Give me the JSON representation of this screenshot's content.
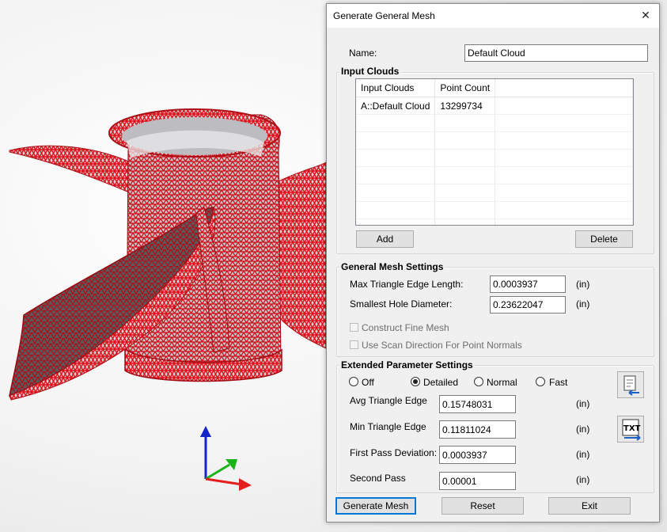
{
  "dialog": {
    "title": "Generate General Mesh",
    "close_glyph": "✕",
    "name_label": "Name:",
    "name_value": "Default Cloud"
  },
  "input_clouds": {
    "group_title": "Input Clouds",
    "columns": [
      "Input Clouds",
      "Point Count"
    ],
    "rows": [
      {
        "cloud": "A::Default Cloud",
        "count": "13299734"
      }
    ],
    "add_label": "Add",
    "delete_label": "Delete"
  },
  "general_settings": {
    "group_title": "General Mesh Settings",
    "max_edge_label": "Max Triangle Edge Length:",
    "max_edge_value": "0.0003937",
    "hole_label": "Smallest Hole Diameter:",
    "hole_value": "0.23622047",
    "unit": "(in)",
    "fine_mesh_label": "Construct Fine Mesh",
    "scan_dir_label": "Use Scan Direction For Point Normals"
  },
  "extended": {
    "group_title": "Extended Parameter Settings",
    "modes": [
      "Off",
      "Detailed",
      "Normal",
      "Fast"
    ],
    "selected_mode": "Detailed",
    "avg_label": "Avg Triangle Edge",
    "avg_value": "0.15748031",
    "min_label": "Min Triangle Edge",
    "min_value": "0.11811024",
    "first_label": "First Pass Deviation:",
    "first_value": "0.0003937",
    "second_label": "Second Pass",
    "second_value": "0.00001",
    "unit": "(in)",
    "txt_icon_label": "TXT"
  },
  "footer": {
    "generate_label": "Generate Mesh",
    "reset_label": "Reset",
    "exit_label": "Exit"
  },
  "colors": {
    "mesh_red": "#e0101a",
    "mesh_dark": "#8a0a10",
    "interior_grey": "#b9b9bd",
    "axis_x": "#e41d1d",
    "axis_y": "#18b418",
    "axis_z": "#1424c8",
    "focus_blue": "#0078d7"
  }
}
